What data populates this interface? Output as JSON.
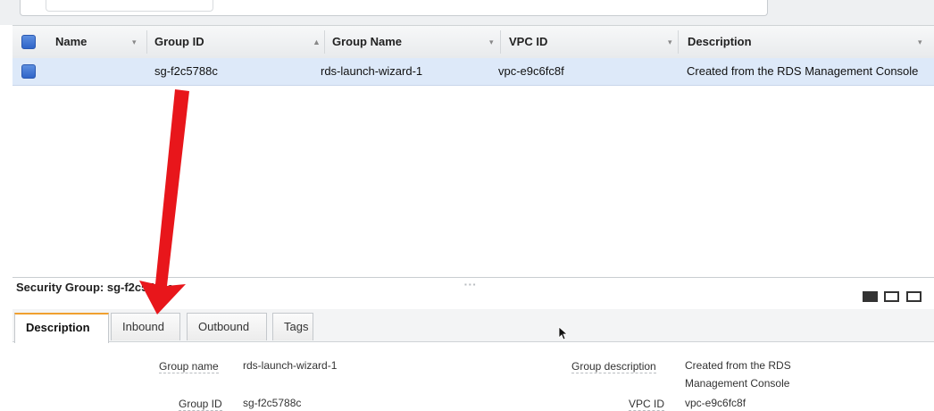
{
  "table": {
    "headers": {
      "name": "Name",
      "group_id": "Group ID",
      "group_name": "Group Name",
      "vpc_id": "VPC ID",
      "description": "Description"
    },
    "rows": [
      {
        "name": "",
        "group_id": "sg-f2c5788c",
        "group_name": "rds-launch-wizard-1",
        "vpc_id": "vpc-e9c6fc8f",
        "description": "Created from the RDS Management Console"
      }
    ]
  },
  "panel": {
    "title": "Security Group: sg-f2c5788c",
    "tabs": [
      "Description",
      "Inbound",
      "Outbound",
      "Tags"
    ],
    "active_tab": "Description",
    "details": {
      "group_name_label": "Group name",
      "group_name_value": "rds-launch-wizard-1",
      "group_id_label": "Group ID",
      "group_id_value": "sg-f2c5788c",
      "group_description_label": "Group description",
      "group_description_value_line1": "Created from the RDS",
      "group_description_value_line2": "Management Console",
      "vpc_id_label": "VPC ID",
      "vpc_id_value": "vpc-e9c6fc8f"
    }
  },
  "colors": {
    "arrow": "#e8161b",
    "active_tab_accent": "#f0a030",
    "selected_row": "#dde9f9",
    "checkbox": "#3a6fd0"
  },
  "icons": {
    "sort_ascending": "up-triangle",
    "sort_dropdown": "down-caret",
    "annotation_arrow": "red-arrow",
    "cursor": "mouse-pointer"
  }
}
